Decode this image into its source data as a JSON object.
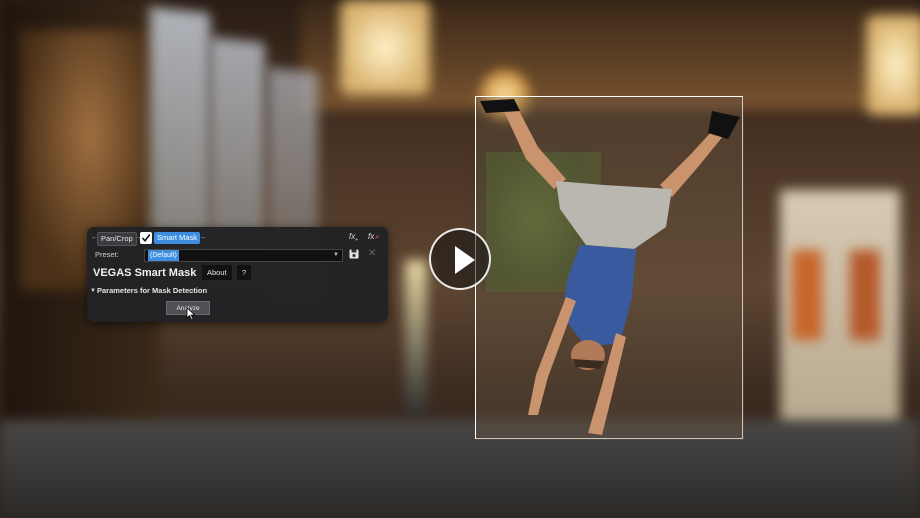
{
  "fx_chain": {
    "items": [
      {
        "label": "Pan/Crop"
      },
      {
        "label": "Smart Mask",
        "checked": true
      }
    ],
    "add_fx_icon": "fx-add-icon",
    "remove_fx_icon": "fx-remove-icon"
  },
  "preset": {
    "label": "Preset:",
    "value": "(Default)"
  },
  "plugin": {
    "title": "VEGAS Smart Mask",
    "about_label": "About",
    "help_label": "?"
  },
  "section": {
    "title": "Parameters for Mask Detection"
  },
  "analyze": {
    "label": "Analyze"
  },
  "colors": {
    "accent": "#3d8de0",
    "panel": "#212124",
    "frame": "#ffffff"
  }
}
